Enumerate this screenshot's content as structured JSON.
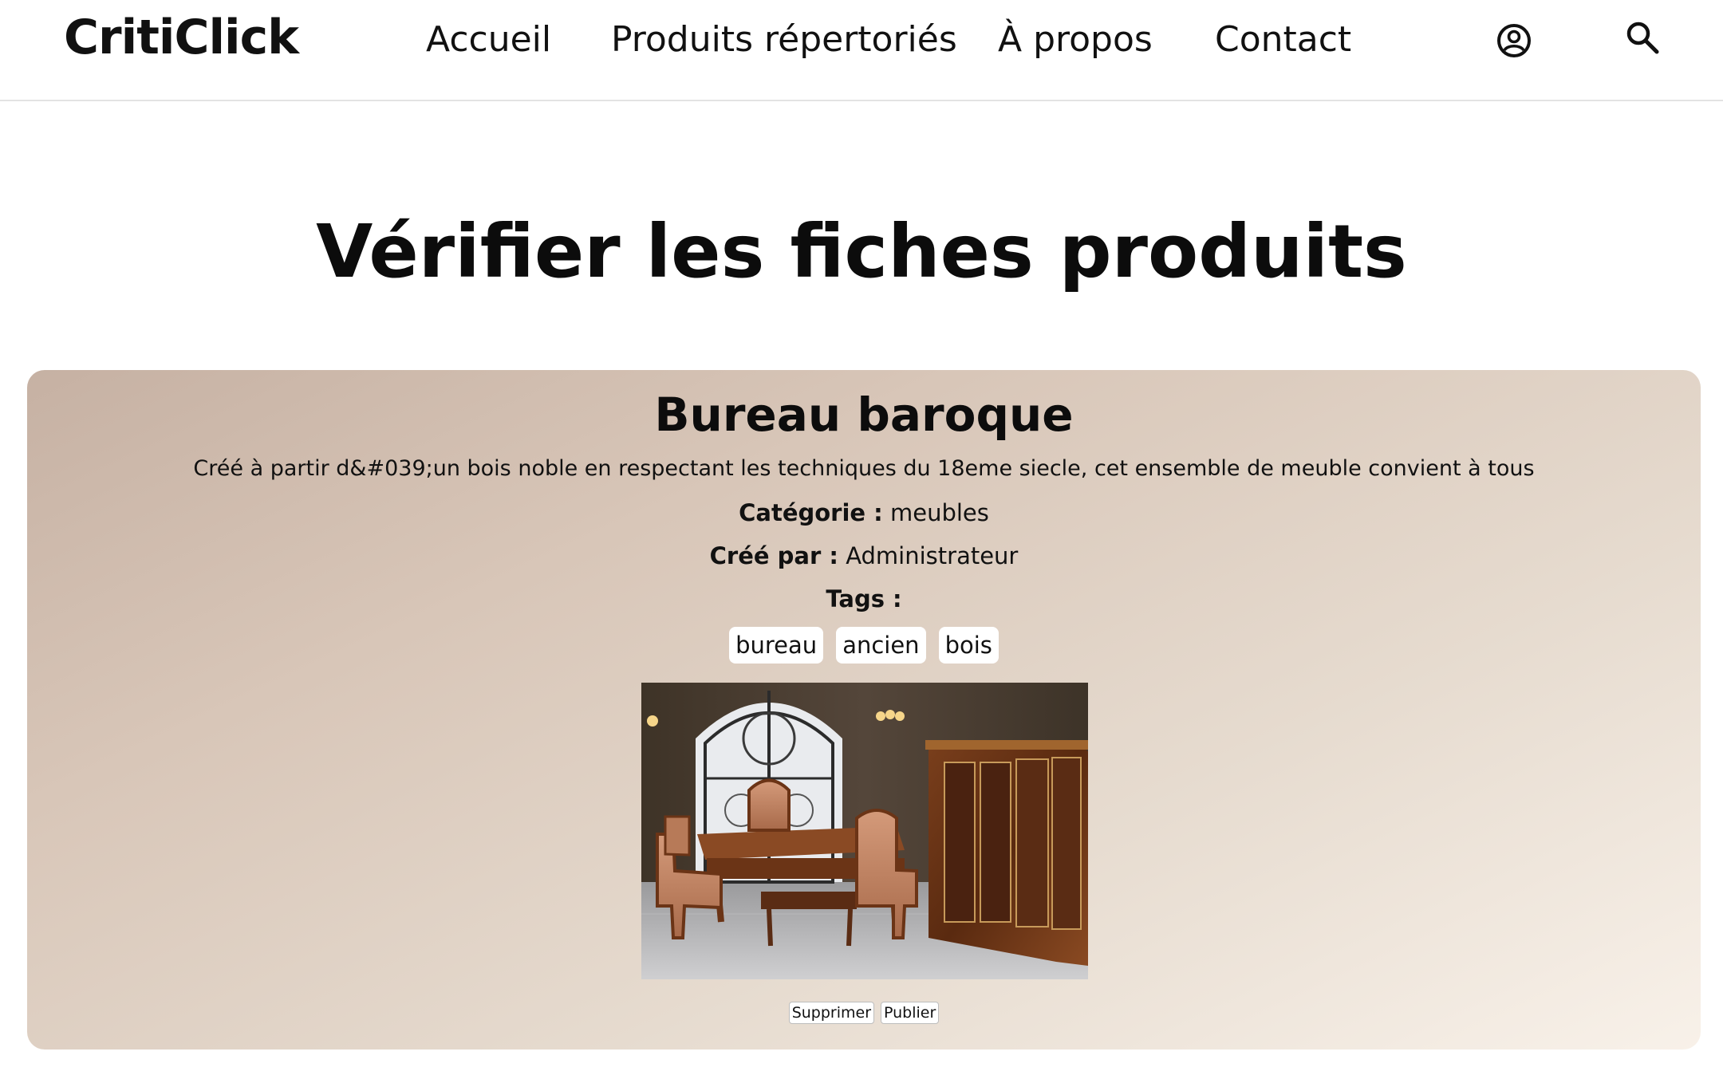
{
  "header": {
    "logo": "CritiClick",
    "nav": {
      "home": "Accueil",
      "products": "Produits répertoriés",
      "about": "À propos",
      "contact": "Contact"
    },
    "icons": {
      "account": "account-circle-icon",
      "search": "search-icon"
    }
  },
  "main": {
    "title": "Vérifier les fiches produits"
  },
  "product": {
    "name": "Bureau baroque",
    "description": "Créé à partir d&#039;un bois noble en respectant les techniques du 18eme siecle, cet ensemble de meuble convient à tous",
    "category_label": "Catégorie :",
    "category_value": "meubles",
    "author_label": "Créé par :",
    "author_value": "Administrateur",
    "tags_label": "Tags :",
    "tags": [
      "bureau",
      "ancien",
      "bois"
    ],
    "actions": {
      "delete": "Supprimer",
      "publish": "Publier"
    }
  },
  "colors": {
    "card_gradient_start": "#c6b1a3",
    "card_gradient_end": "#f8f1e9",
    "text": "#111111",
    "divider": "#e3e3e3"
  }
}
